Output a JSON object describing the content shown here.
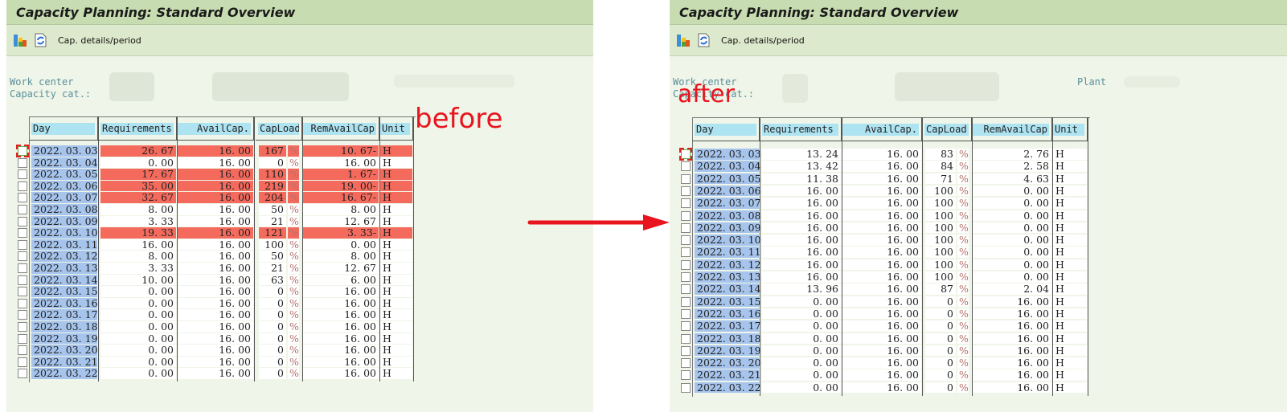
{
  "annotations": {
    "before": "before",
    "after": "after",
    "arrow": "red-right-arrow"
  },
  "screens": [
    {
      "id": "before",
      "title": "Capacity Planning: Standard Overview",
      "toolbar": {
        "icons": [
          "capacity-chart-icon",
          "refresh-document-icon"
        ],
        "button_label": "Cap. details/period"
      },
      "header_fields": {
        "work_center_label": "Work center",
        "capacity_cat_label": "Capacity cat.:",
        "plant_label": ""
      },
      "columns": [
        "Day",
        "Requirements",
        "AvailCap.",
        "CapLoad",
        "RemAvailCap",
        "Unit"
      ],
      "highlight_color": "#f46b5e",
      "rows": [
        {
          "day": "2022.03.03",
          "req": "26.67",
          "avail": "16.00",
          "load": "167",
          "rem": "10.67-",
          "unit": "H",
          "over": true
        },
        {
          "day": "2022.03.04",
          "req": "0.00",
          "avail": "16.00",
          "load": "0",
          "rem": "16.00",
          "unit": "H",
          "over": false
        },
        {
          "day": "2022.03.05",
          "req": "17.67",
          "avail": "16.00",
          "load": "110",
          "rem": "1.67-",
          "unit": "H",
          "over": true
        },
        {
          "day": "2022.03.06",
          "req": "35.00",
          "avail": "16.00",
          "load": "219",
          "rem": "19.00-",
          "unit": "H",
          "over": true
        },
        {
          "day": "2022.03.07",
          "req": "32.67",
          "avail": "16.00",
          "load": "204",
          "rem": "16.67-",
          "unit": "H",
          "over": true
        },
        {
          "day": "2022.03.08",
          "req": "8.00",
          "avail": "16.00",
          "load": "50",
          "rem": "8.00",
          "unit": "H",
          "over": false
        },
        {
          "day": "2022.03.09",
          "req": "3.33",
          "avail": "16.00",
          "load": "21",
          "rem": "12.67",
          "unit": "H",
          "over": false
        },
        {
          "day": "2022.03.10",
          "req": "19.33",
          "avail": "16.00",
          "load": "121",
          "rem": "3.33-",
          "unit": "H",
          "over": true
        },
        {
          "day": "2022.03.11",
          "req": "16.00",
          "avail": "16.00",
          "load": "100",
          "rem": "0.00",
          "unit": "H",
          "over": false
        },
        {
          "day": "2022.03.12",
          "req": "8.00",
          "avail": "16.00",
          "load": "50",
          "rem": "8.00",
          "unit": "H",
          "over": false
        },
        {
          "day": "2022.03.13",
          "req": "3.33",
          "avail": "16.00",
          "load": "21",
          "rem": "12.67",
          "unit": "H",
          "over": false
        },
        {
          "day": "2022.03.14",
          "req": "10.00",
          "avail": "16.00",
          "load": "63",
          "rem": "6.00",
          "unit": "H",
          "over": false
        },
        {
          "day": "2022.03.15",
          "req": "0.00",
          "avail": "16.00",
          "load": "0",
          "rem": "16.00",
          "unit": "H",
          "over": false
        },
        {
          "day": "2022.03.16",
          "req": "0.00",
          "avail": "16.00",
          "load": "0",
          "rem": "16.00",
          "unit": "H",
          "over": false
        },
        {
          "day": "2022.03.17",
          "req": "0.00",
          "avail": "16.00",
          "load": "0",
          "rem": "16.00",
          "unit": "H",
          "over": false
        },
        {
          "day": "2022.03.18",
          "req": "0.00",
          "avail": "16.00",
          "load": "0",
          "rem": "16.00",
          "unit": "H",
          "over": false
        },
        {
          "day": "2022.03.19",
          "req": "0.00",
          "avail": "16.00",
          "load": "0",
          "rem": "16.00",
          "unit": "H",
          "over": false
        },
        {
          "day": "2022.03.20",
          "req": "0.00",
          "avail": "16.00",
          "load": "0",
          "rem": "16.00",
          "unit": "H",
          "over": false
        },
        {
          "day": "2022.03.21",
          "req": "0.00",
          "avail": "16.00",
          "load": "0",
          "rem": "16.00",
          "unit": "H",
          "over": false
        },
        {
          "day": "2022.03.22",
          "req": "0.00",
          "avail": "16.00",
          "load": "0",
          "rem": "16.00",
          "unit": "H",
          "over": false
        }
      ]
    },
    {
      "id": "after",
      "title": "Capacity Planning: Standard Overview",
      "toolbar": {
        "icons": [
          "capacity-chart-icon",
          "refresh-document-icon"
        ],
        "button_label": "Cap. details/period"
      },
      "header_fields": {
        "work_center_label": "Work center",
        "capacity_cat_label": "Capacity cat.:",
        "plant_label": "Plant"
      },
      "columns": [
        "Day",
        "Requirements",
        "AvailCap.",
        "CapLoad",
        "RemAvailCap",
        "Unit"
      ],
      "highlight_color": "#f46b5e",
      "rows": [
        {
          "day": "2022.03.03",
          "req": "13.24",
          "avail": "16.00",
          "load": "83",
          "rem": "2.76",
          "unit": "H",
          "over": false
        },
        {
          "day": "2022.03.04",
          "req": "13.42",
          "avail": "16.00",
          "load": "84",
          "rem": "2.58",
          "unit": "H",
          "over": false
        },
        {
          "day": "2022.03.05",
          "req": "11.38",
          "avail": "16.00",
          "load": "71",
          "rem": "4.63",
          "unit": "H",
          "over": false
        },
        {
          "day": "2022.03.06",
          "req": "16.00",
          "avail": "16.00",
          "load": "100",
          "rem": "0.00",
          "unit": "H",
          "over": false
        },
        {
          "day": "2022.03.07",
          "req": "16.00",
          "avail": "16.00",
          "load": "100",
          "rem": "0.00",
          "unit": "H",
          "over": false
        },
        {
          "day": "2022.03.08",
          "req": "16.00",
          "avail": "16.00",
          "load": "100",
          "rem": "0.00",
          "unit": "H",
          "over": false
        },
        {
          "day": "2022.03.09",
          "req": "16.00",
          "avail": "16.00",
          "load": "100",
          "rem": "0.00",
          "unit": "H",
          "over": false
        },
        {
          "day": "2022.03.10",
          "req": "16.00",
          "avail": "16.00",
          "load": "100",
          "rem": "0.00",
          "unit": "H",
          "over": false
        },
        {
          "day": "2022.03.11",
          "req": "16.00",
          "avail": "16.00",
          "load": "100",
          "rem": "0.00",
          "unit": "H",
          "over": false
        },
        {
          "day": "2022.03.12",
          "req": "16.00",
          "avail": "16.00",
          "load": "100",
          "rem": "0.00",
          "unit": "H",
          "over": false
        },
        {
          "day": "2022.03.13",
          "req": "16.00",
          "avail": "16.00",
          "load": "100",
          "rem": "0.00",
          "unit": "H",
          "over": false
        },
        {
          "day": "2022.03.14",
          "req": "13.96",
          "avail": "16.00",
          "load": "87",
          "rem": "2.04",
          "unit": "H",
          "over": false
        },
        {
          "day": "2022.03.15",
          "req": "0.00",
          "avail": "16.00",
          "load": "0",
          "rem": "16.00",
          "unit": "H",
          "over": false
        },
        {
          "day": "2022.03.16",
          "req": "0.00",
          "avail": "16.00",
          "load": "0",
          "rem": "16.00",
          "unit": "H",
          "over": false
        },
        {
          "day": "2022.03.17",
          "req": "0.00",
          "avail": "16.00",
          "load": "0",
          "rem": "16.00",
          "unit": "H",
          "over": false
        },
        {
          "day": "2022.03.18",
          "req": "0.00",
          "avail": "16.00",
          "load": "0",
          "rem": "16.00",
          "unit": "H",
          "over": false
        },
        {
          "day": "2022.03.19",
          "req": "0.00",
          "avail": "16.00",
          "load": "0",
          "rem": "16.00",
          "unit": "H",
          "over": false
        },
        {
          "day": "2022.03.20",
          "req": "0.00",
          "avail": "16.00",
          "load": "0",
          "rem": "16.00",
          "unit": "H",
          "over": false
        },
        {
          "day": "2022.03.21",
          "req": "0.00",
          "avail": "16.00",
          "load": "0",
          "rem": "16.00",
          "unit": "H",
          "over": false
        },
        {
          "day": "2022.03.22",
          "req": "0.00",
          "avail": "16.00",
          "load": "0",
          "rem": "16.00",
          "unit": "H",
          "over": false
        }
      ],
      "percent_sign": "%"
    }
  ],
  "percent_sign": "%"
}
